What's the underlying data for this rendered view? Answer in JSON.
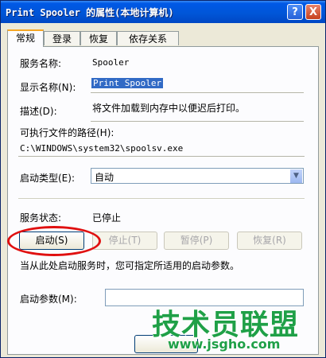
{
  "window": {
    "title": "Print Spooler 的属性(本地计算机)",
    "help_glyph": "?",
    "close_glyph": "X"
  },
  "tabs": [
    {
      "label": "常规",
      "active": true
    },
    {
      "label": "登录",
      "active": false
    },
    {
      "label": "恢复",
      "active": false
    },
    {
      "label": "依存关系",
      "active": false
    }
  ],
  "general": {
    "service_name_label": "服务名称:",
    "service_name_value": "Spooler",
    "display_name_label": "显示名称(N):",
    "display_name_value": "Print Spooler",
    "description_label": "描述(D):",
    "description_value": "将文件加载到内存中以便迟后打印。",
    "exe_path_label": "可执行文件的路径(H):",
    "exe_path_value": "C:\\WINDOWS\\system32\\spoolsv.exe",
    "startup_type_label": "启动类型(E):",
    "startup_type_value": "自动",
    "status_label": "服务状态:",
    "status_value": "已停止",
    "buttons": {
      "start": "启动(S)",
      "stop": "停止(T)",
      "pause": "暂停(P)",
      "resume": "恢复(R)"
    },
    "hint_text": "当从此处启动服务时，您可指定所适用的启动参数。",
    "start_params_label": "启动参数(M):",
    "start_params_value": ""
  },
  "watermark": {
    "brand": "技术员联盟",
    "url": "www.jsgho.com"
  },
  "colors": {
    "titlebar": "#0058e6",
    "highlight": "#e01010",
    "watermark": "#1fa047",
    "selection": "#316ac5"
  }
}
